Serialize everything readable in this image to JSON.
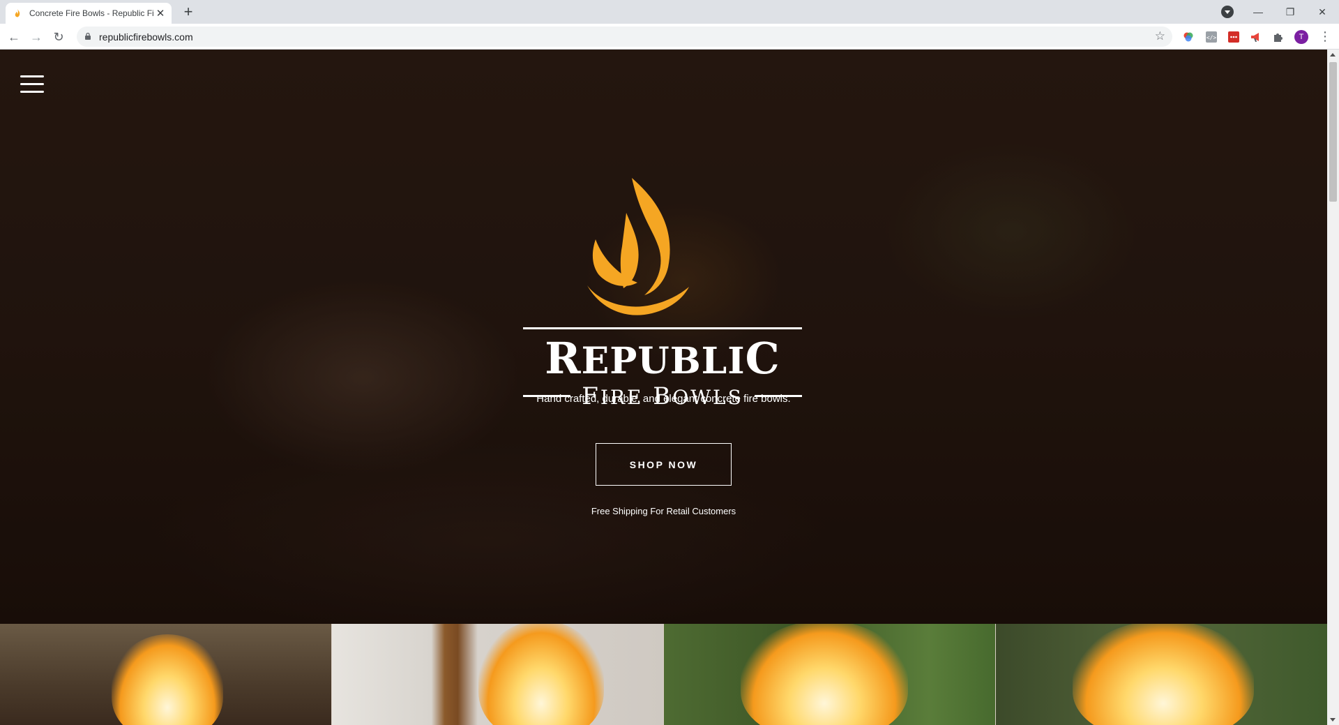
{
  "browser": {
    "tab_title": "Concrete Fire Bowls - Republic Fi",
    "new_tab_glyph": "+",
    "url": "republicfirebowls.com",
    "profile_initial": "T",
    "extensions": [
      "color-picker-icon",
      "code-icon",
      "lastpass-icon",
      "megaphone-icon",
      "puzzle-icon"
    ]
  },
  "hero": {
    "logo_alt": "Republic Fire Bowls",
    "tagline": "Hand crafted, durable, and elegant concrete fire bowls.",
    "cta_label": "SHOP NOW",
    "shipping_note": "Free Shipping For Retail Customers"
  },
  "colors": {
    "flame_orange": "#F5A623",
    "text_white": "#FFFFFF",
    "hero_dark": "#24160F"
  },
  "tiles": [
    "fire-bowl-photo-1",
    "fire-bowl-photo-2",
    "fire-bowl-photo-3",
    "fire-bowl-photo-4"
  ]
}
